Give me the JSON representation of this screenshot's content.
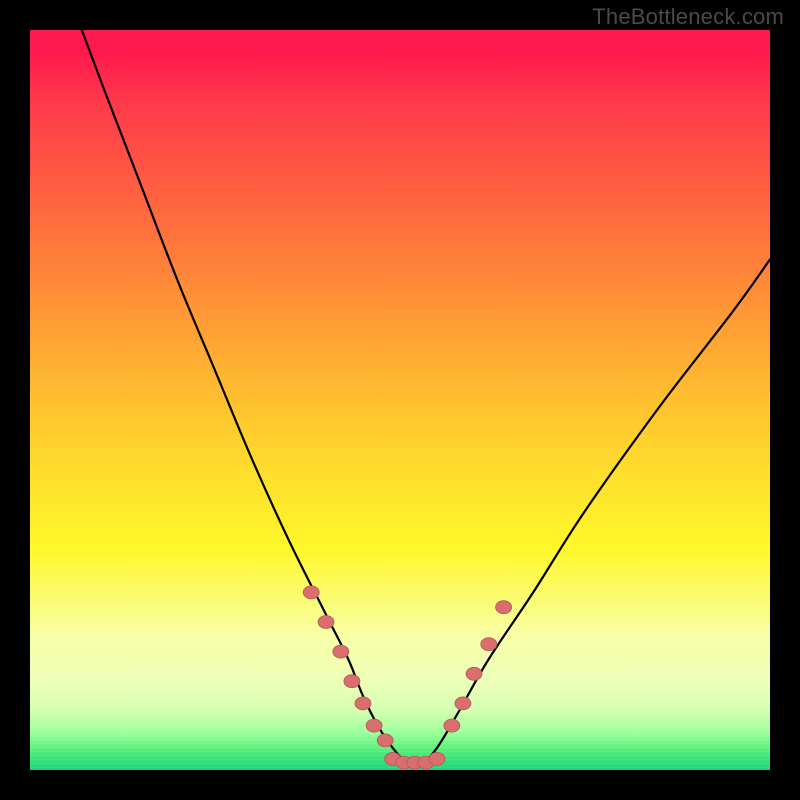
{
  "watermark": "TheBottleneck.com",
  "colors": {
    "frame": "#000000",
    "gradient_top": "#ff1a4d",
    "gradient_mid": "#fff82a",
    "gradient_bottom": "#20d27a",
    "curve": "#000000",
    "marker_fill": "#da6e6e",
    "marker_stroke": "#b25a5a"
  },
  "chart_data": {
    "type": "line",
    "title": "",
    "xlabel": "",
    "ylabel": "",
    "xlim": [
      0,
      100
    ],
    "ylim": [
      0,
      100
    ],
    "legend": false,
    "grid": false,
    "annotations": [
      "TheBottleneck.com"
    ],
    "series": [
      {
        "name": "bottleneck-curve",
        "x": [
          7,
          10,
          15,
          20,
          25,
          30,
          35,
          40,
          43,
          45,
          47,
          49,
          51,
          53,
          55,
          58,
          62,
          68,
          75,
          85,
          95,
          100
        ],
        "values": [
          100,
          92,
          79,
          66,
          54,
          42,
          31,
          21,
          15,
          10,
          6,
          3,
          1,
          1,
          3,
          8,
          15,
          24,
          35,
          49,
          62,
          69
        ]
      }
    ],
    "markers_left": {
      "x": [
        38,
        40,
        42,
        43.5,
        45,
        46.5,
        48
      ],
      "y": [
        24,
        20,
        16,
        12,
        9,
        6,
        4
      ]
    },
    "markers_floor": {
      "x": [
        49,
        50.5,
        52,
        53.5,
        55
      ],
      "y": [
        1.5,
        1,
        1,
        1,
        1.5
      ]
    },
    "markers_right": {
      "x": [
        57,
        58.5,
        60,
        62,
        64
      ],
      "y": [
        6,
        9,
        13,
        17,
        22
      ]
    }
  }
}
